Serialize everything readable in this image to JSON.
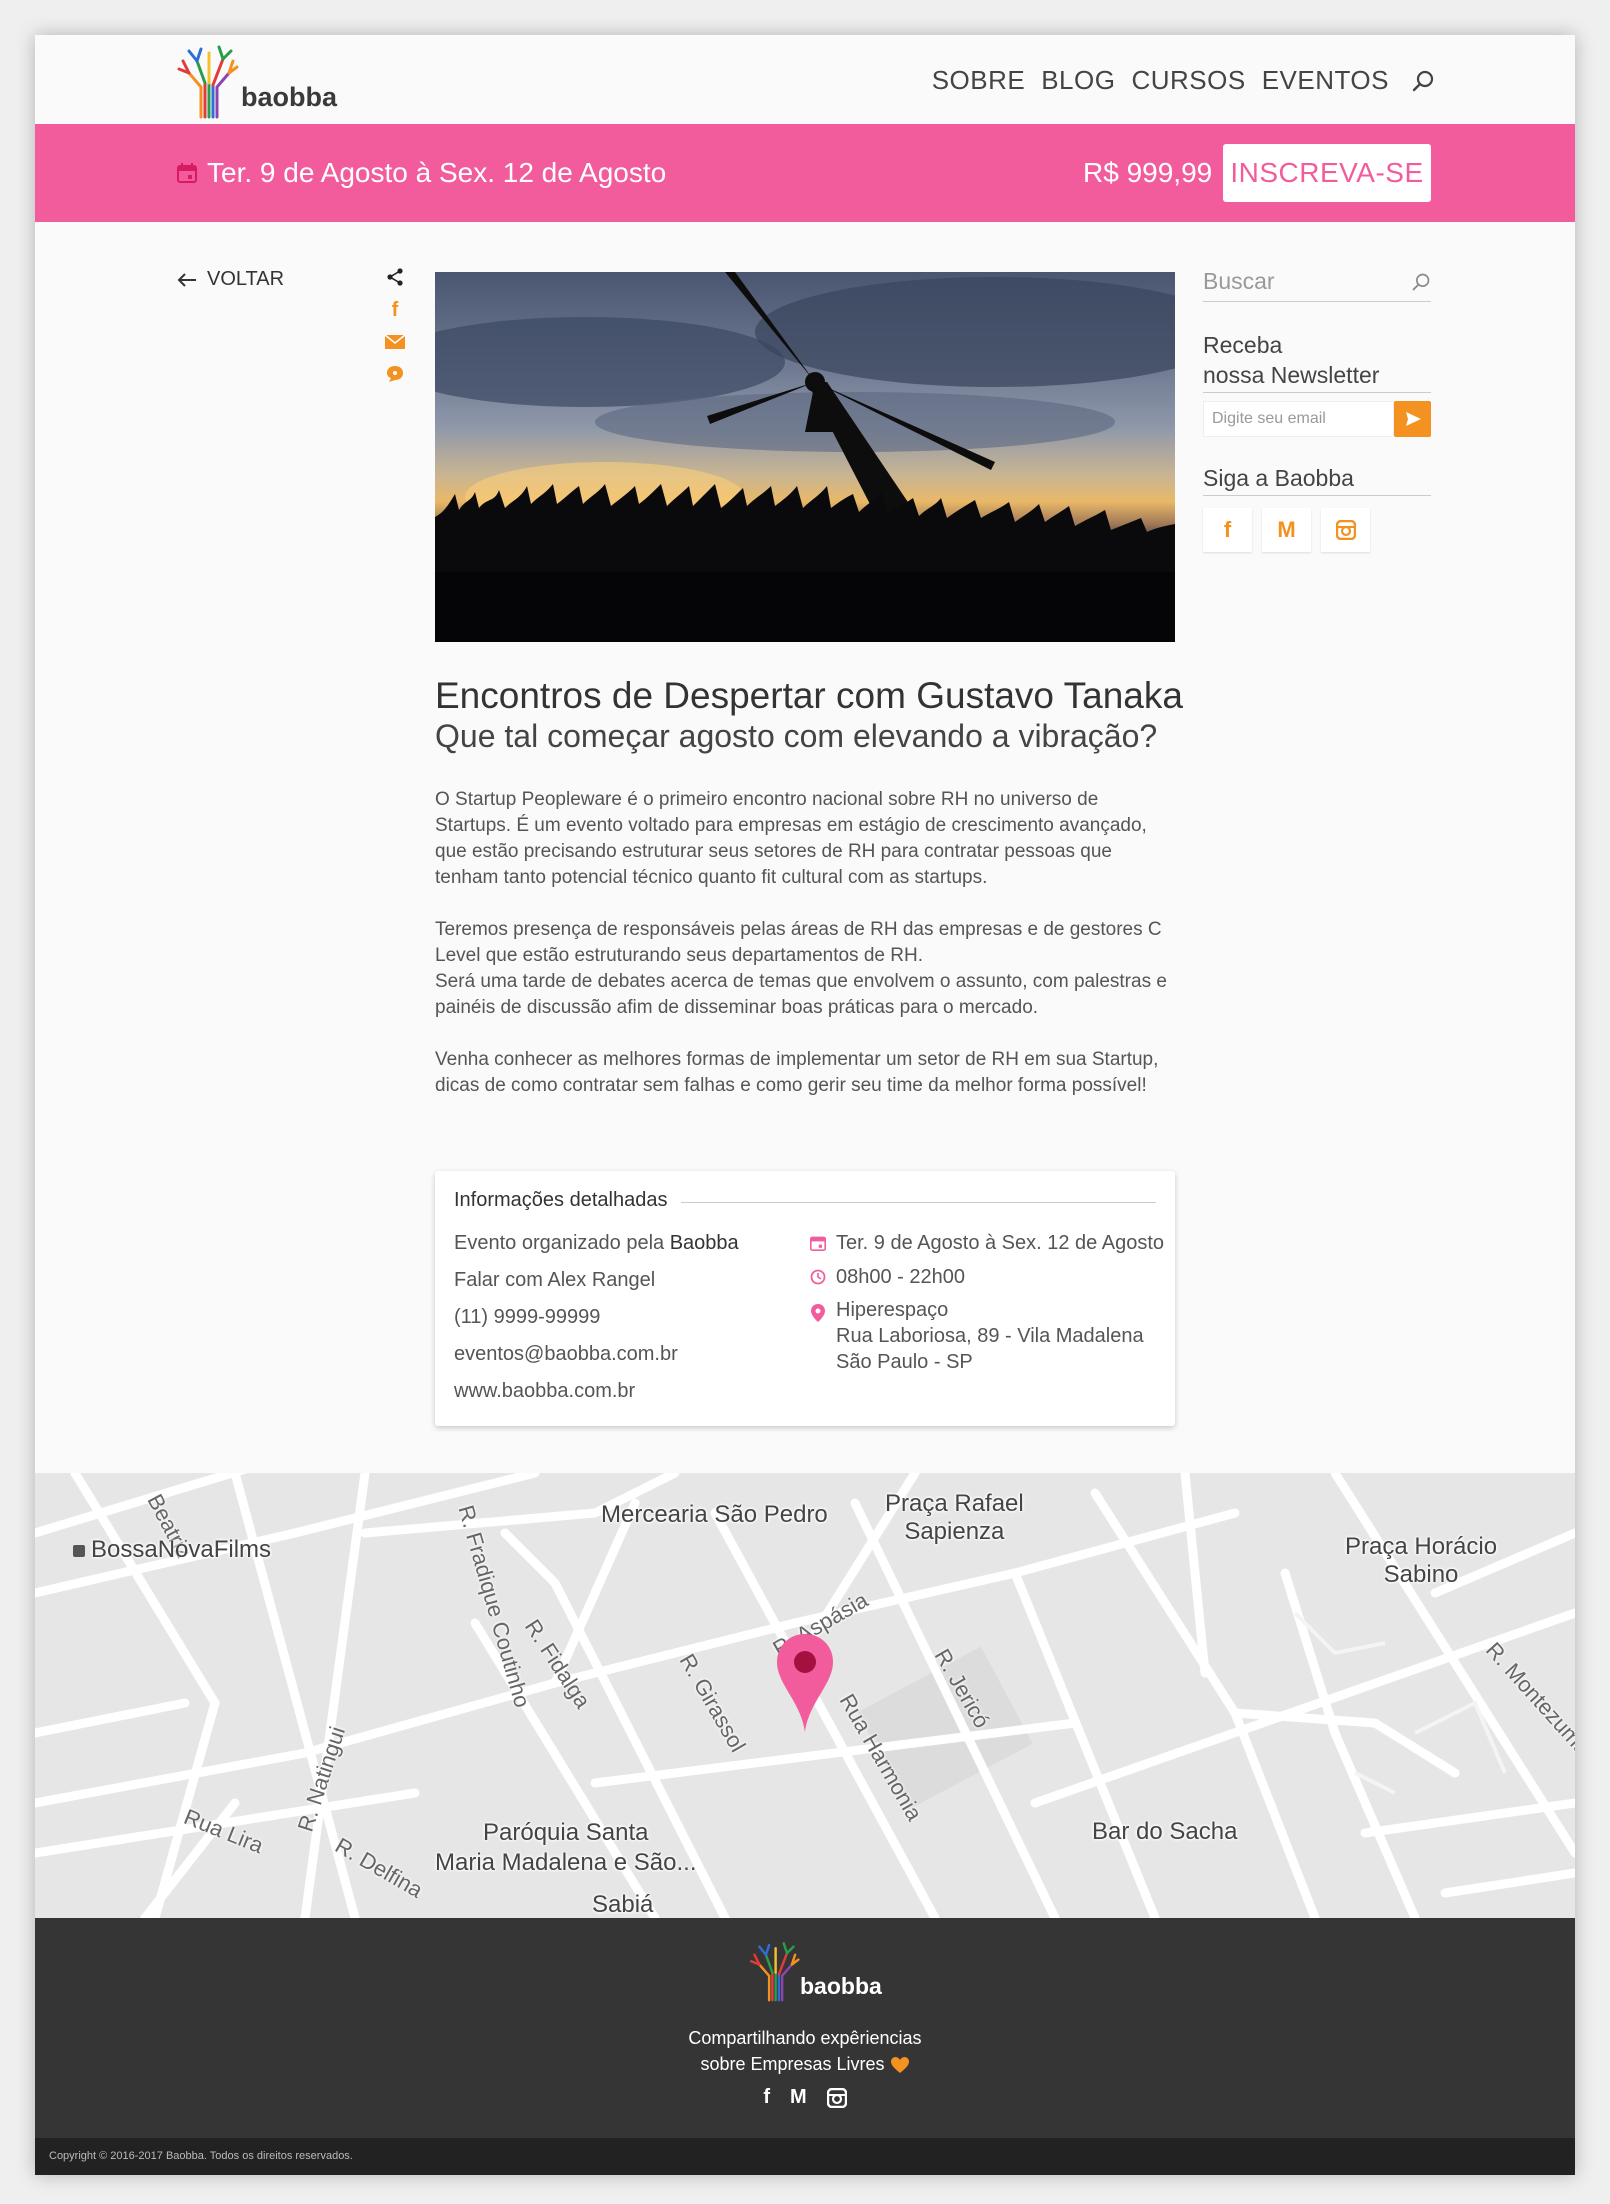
{
  "brand": {
    "name": "baobba"
  },
  "nav": {
    "items": [
      "SOBRE",
      "BLOG",
      "CURSOS",
      "EVENTOS"
    ],
    "search_icon": "search-icon"
  },
  "event_bar": {
    "date": "Ter. 9 de Agosto à Sex. 12 de Agosto",
    "price": "R$ 999,99",
    "cta": "INSCREVA-SE",
    "color": "#f25c9c"
  },
  "back_label": "VOLTAR",
  "share_icons": [
    "share-icon",
    "facebook-icon",
    "email-icon",
    "comment-icon"
  ],
  "article": {
    "title": "Encontros de Despertar com Gustavo Tanaka",
    "subtitle": "Que tal começar agosto com elevando a vibração?",
    "paragraphs": [
      "O Startup Peopleware é o primeiro encontro nacional sobre RH no universo de Startups. É um evento voltado para empresas em estágio de crescimento avançado, que estão precisando estruturar seus setores de RH para contratar pessoas que tenham tanto potencial técnico quanto fit cultural com as startups.",
      "Teremos presença de responsáveis pelas áreas de RH das empresas e de gestores C Level que estão estruturando seus departamentos de RH.",
      "Será uma tarde de debates acerca de temas que envolvem o assunto, com palestras e painéis de discussão afim de disseminar boas práticas para o mercado.",
      "Venha conhecer as melhores formas de implementar um setor de RH em sua Startup, dicas de como contratar sem falhas e como gerir seu time da melhor forma possível!"
    ]
  },
  "info": {
    "heading": "Informações detalhadas",
    "organized_prefix": "Evento organizado pela",
    "organizer": "Baobba",
    "contact": "Falar com Alex Rangel",
    "phone": "(11) 9999-99999",
    "email": "eventos@baobba.com.br",
    "site": "www.baobba.com.br",
    "date": "Ter. 9 de Agosto à Sex. 12 de Agosto",
    "time": "08h00 - 22h00",
    "venue": "Hiperespaço",
    "address1": "Rua Laboriosa, 89 - Vila Madalena",
    "address2": "São Paulo - SP"
  },
  "sidebar": {
    "search_placeholder": "Buscar",
    "newsletter_line1": "Receba",
    "newsletter_line2": "nossa Newsletter",
    "email_placeholder": "Digite seu email",
    "follow": "Siga a Baobba",
    "social_icons": [
      "facebook-icon",
      "medium-icon",
      "instagram-icon"
    ],
    "accent": "#f39220"
  },
  "map": {
    "places": {
      "bossanova": "BossaNovaFilms",
      "mercearia": "Mercearia São Pedro",
      "praca_rafael_1": "Praça Rafael",
      "praca_rafael_2": "Sapienza",
      "praca_horacio_1": "Praça Horácio",
      "praca_horacio_2": "Sabino",
      "paroquia_1": "Paróquia Santa",
      "paroquia_2": "Maria Madalena e São...",
      "bar": "Bar do Sacha",
      "sabia": "Sabiá"
    },
    "streets": {
      "beatriz": "Beatriz",
      "fradique": "R. Fradique Coutinho",
      "fidalga": "R. Fidalga",
      "girassol": "R. Girassol",
      "harmonia": "Rua Harmonia",
      "jerico": "R. Jericó",
      "montezuma": "R. Montezuma",
      "natingui": "R. Natingui",
      "delfina": "R. Delfina",
      "lira": "Rua Lira",
      "aspasia": "R. Aspásia"
    }
  },
  "footer": {
    "tagline1": "Compartilhando expêriencias",
    "tagline2": "sobre Empresas Livres",
    "copyright": "Copyright © 2016-2017 Baobba. Todos os direitos reservados."
  }
}
